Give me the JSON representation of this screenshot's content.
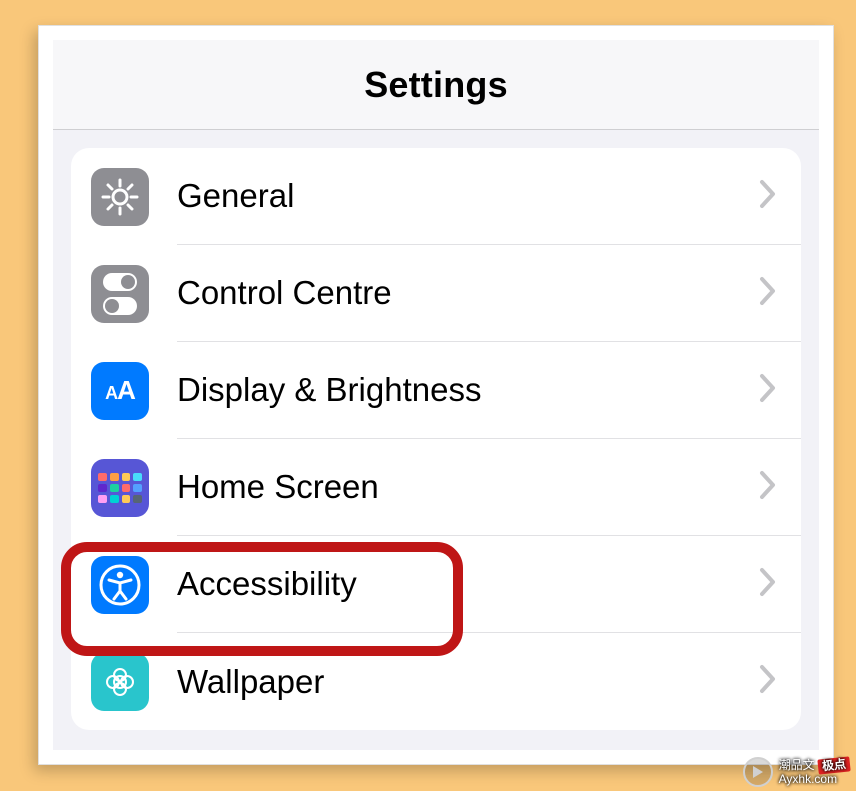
{
  "header": {
    "title": "Settings"
  },
  "rows": [
    {
      "icon": "gear-icon",
      "label": "General"
    },
    {
      "icon": "control-centre-icon",
      "label": "Control Centre"
    },
    {
      "icon": "display-icon",
      "label": "Display & Brightness"
    },
    {
      "icon": "home-screen-icon",
      "label": "Home Screen"
    },
    {
      "icon": "accessibility-icon",
      "label": "Accessibility"
    },
    {
      "icon": "wallpaper-icon",
      "label": "Wallpaper"
    }
  ],
  "highlight": {
    "row_index": 4,
    "color": "#bf1616"
  },
  "watermark": {
    "badge": "极点",
    "line1": "潮品文",
    "line2": "Ayxhk.com"
  },
  "home_grid_colors": [
    "#ff6b6b",
    "#ff9f43",
    "#feca57",
    "#48dbfb",
    "#5f27cd",
    "#1dd1a1",
    "#ff6b6b",
    "#54a0ff",
    "#ff9ff3",
    "#00d2d3",
    "#feca57",
    "#576574"
  ]
}
